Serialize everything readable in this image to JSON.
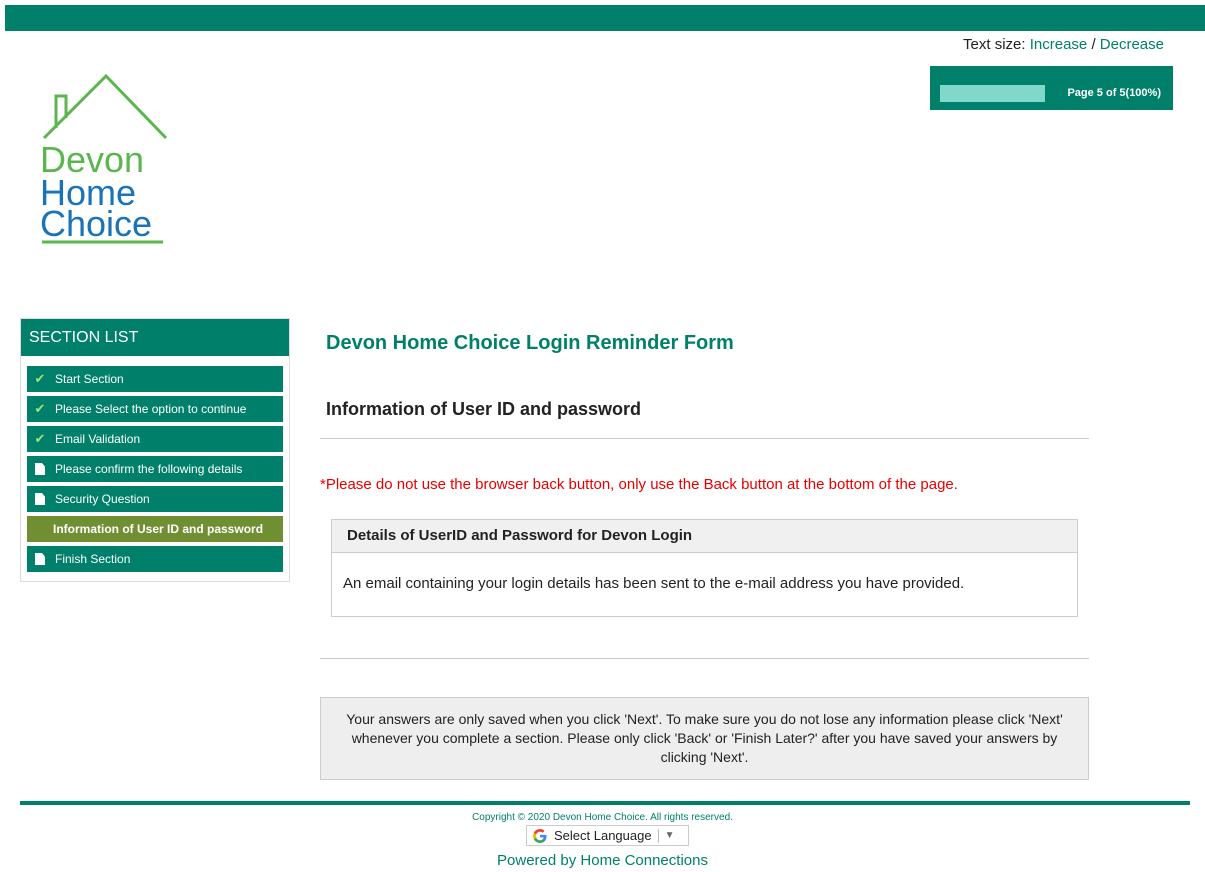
{
  "header": {
    "text_size_label": "Text size:",
    "increase_label": "Increase",
    "separator": "/",
    "decrease_label": "Decrease"
  },
  "progress": {
    "label": "Page 5 of 5(100%)",
    "percent": 100,
    "fill_color": "#7fd8c9"
  },
  "logo": {
    "line1": "Devon",
    "line2": "Home",
    "line3": "Choice"
  },
  "sidebar": {
    "title": "SECTION LIST",
    "items": [
      {
        "label": "Start Section",
        "status": "complete",
        "icon": "check-icon"
      },
      {
        "label": "Please Select the option to continue",
        "status": "complete",
        "icon": "check-icon"
      },
      {
        "label": "Email Validation",
        "status": "complete",
        "icon": "check-icon"
      },
      {
        "label": "Please confirm the following details",
        "status": "pending",
        "icon": "document-icon"
      },
      {
        "label": "Security Question",
        "status": "pending",
        "icon": "document-icon"
      },
      {
        "label": "Information of User ID and password",
        "status": "current",
        "icon": ""
      },
      {
        "label": "Finish Section",
        "status": "pending",
        "icon": "document-icon"
      }
    ]
  },
  "main": {
    "form_title": "Devon Home Choice Login Reminder Form",
    "section_title": "Information of User ID and password",
    "warning": "*Please do not use the browser back button, only use the Back button at the bottom of the page.",
    "panel_title": "Details of UserID and Password for Devon Login",
    "panel_body": "An email containing your login details has been sent to the e-mail address you have provided.",
    "notice": "Your answers are only saved when you click 'Next'. To make sure you do not lose any information please click 'Next' whenever you complete a section. Please only click 'Back' or 'Finish Later?' after you have saved your answers by clicking 'Next'."
  },
  "footer": {
    "copyright": "Copyright © 2020 Devon Home Choice. All rights reserved.",
    "language_label": "Select Language",
    "language_arrow": "▼",
    "powered_by": "Powered by Home Connections"
  },
  "colors": {
    "brand_green": "#00806a",
    "active_item": "#6f8f32",
    "warning_red": "#e80000",
    "logo_green": "#5bb64e",
    "logo_blue": "#1a73b8"
  }
}
